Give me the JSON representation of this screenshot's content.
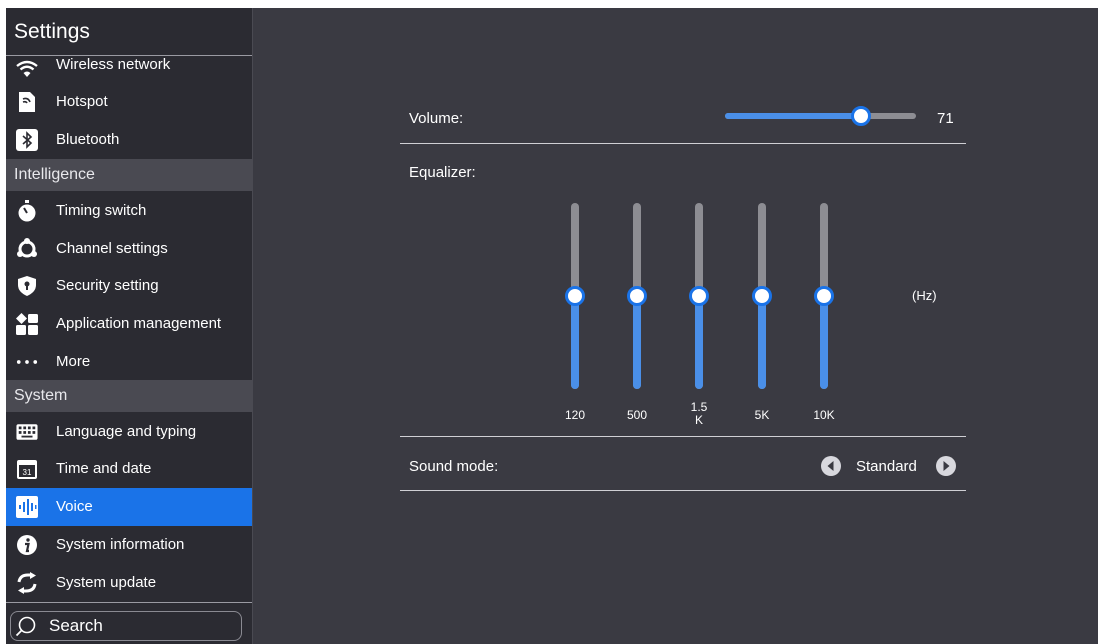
{
  "sidebar": {
    "title": "Settings",
    "items_top": [
      {
        "label": "Wireless network",
        "icon": "wifi-icon"
      },
      {
        "label": "Hotspot",
        "icon": "hotspot-icon"
      },
      {
        "label": "Bluetooth",
        "icon": "bluetooth-icon"
      }
    ],
    "section_intelligence": "Intelligence",
    "items_intelligence": [
      {
        "label": "Timing switch",
        "icon": "stopwatch-icon"
      },
      {
        "label": "Channel settings",
        "icon": "channel-icon"
      },
      {
        "label": "Security setting",
        "icon": "shield-icon"
      },
      {
        "label": "Application management",
        "icon": "apps-grid-icon"
      },
      {
        "label": "More",
        "icon": "more-dots-icon"
      }
    ],
    "section_system": "System",
    "items_system": [
      {
        "label": "Language and typing",
        "icon": "keyboard-icon"
      },
      {
        "label": "Time and date",
        "icon": "calendar-icon",
        "icon_text": "31"
      },
      {
        "label": "Voice",
        "icon": "voice-wave-icon"
      },
      {
        "label": "System information",
        "icon": "info-icon"
      },
      {
        "label": "System update",
        "icon": "update-icon"
      }
    ],
    "search_label": "Search"
  },
  "main": {
    "volume_label": "Volume:",
    "volume_value": "71",
    "volume_level": 71,
    "equalizer_label": "Equalizer:",
    "eq_unit": "(Hz)",
    "eq_bands": [
      {
        "label": "120",
        "level": 0.5
      },
      {
        "label": "500",
        "level": 0.5
      },
      {
        "label": "1.5\nK",
        "level": 0.5
      },
      {
        "label": "5K",
        "level": 0.5
      },
      {
        "label": "10K",
        "level": 0.5
      }
    ],
    "sound_mode_label": "Sound mode:",
    "sound_mode_value": "Standard"
  },
  "colors": {
    "accent": "#1a73e8",
    "panel_bg": "#3a3a42",
    "sidebar_bg": "#2b2b32"
  }
}
